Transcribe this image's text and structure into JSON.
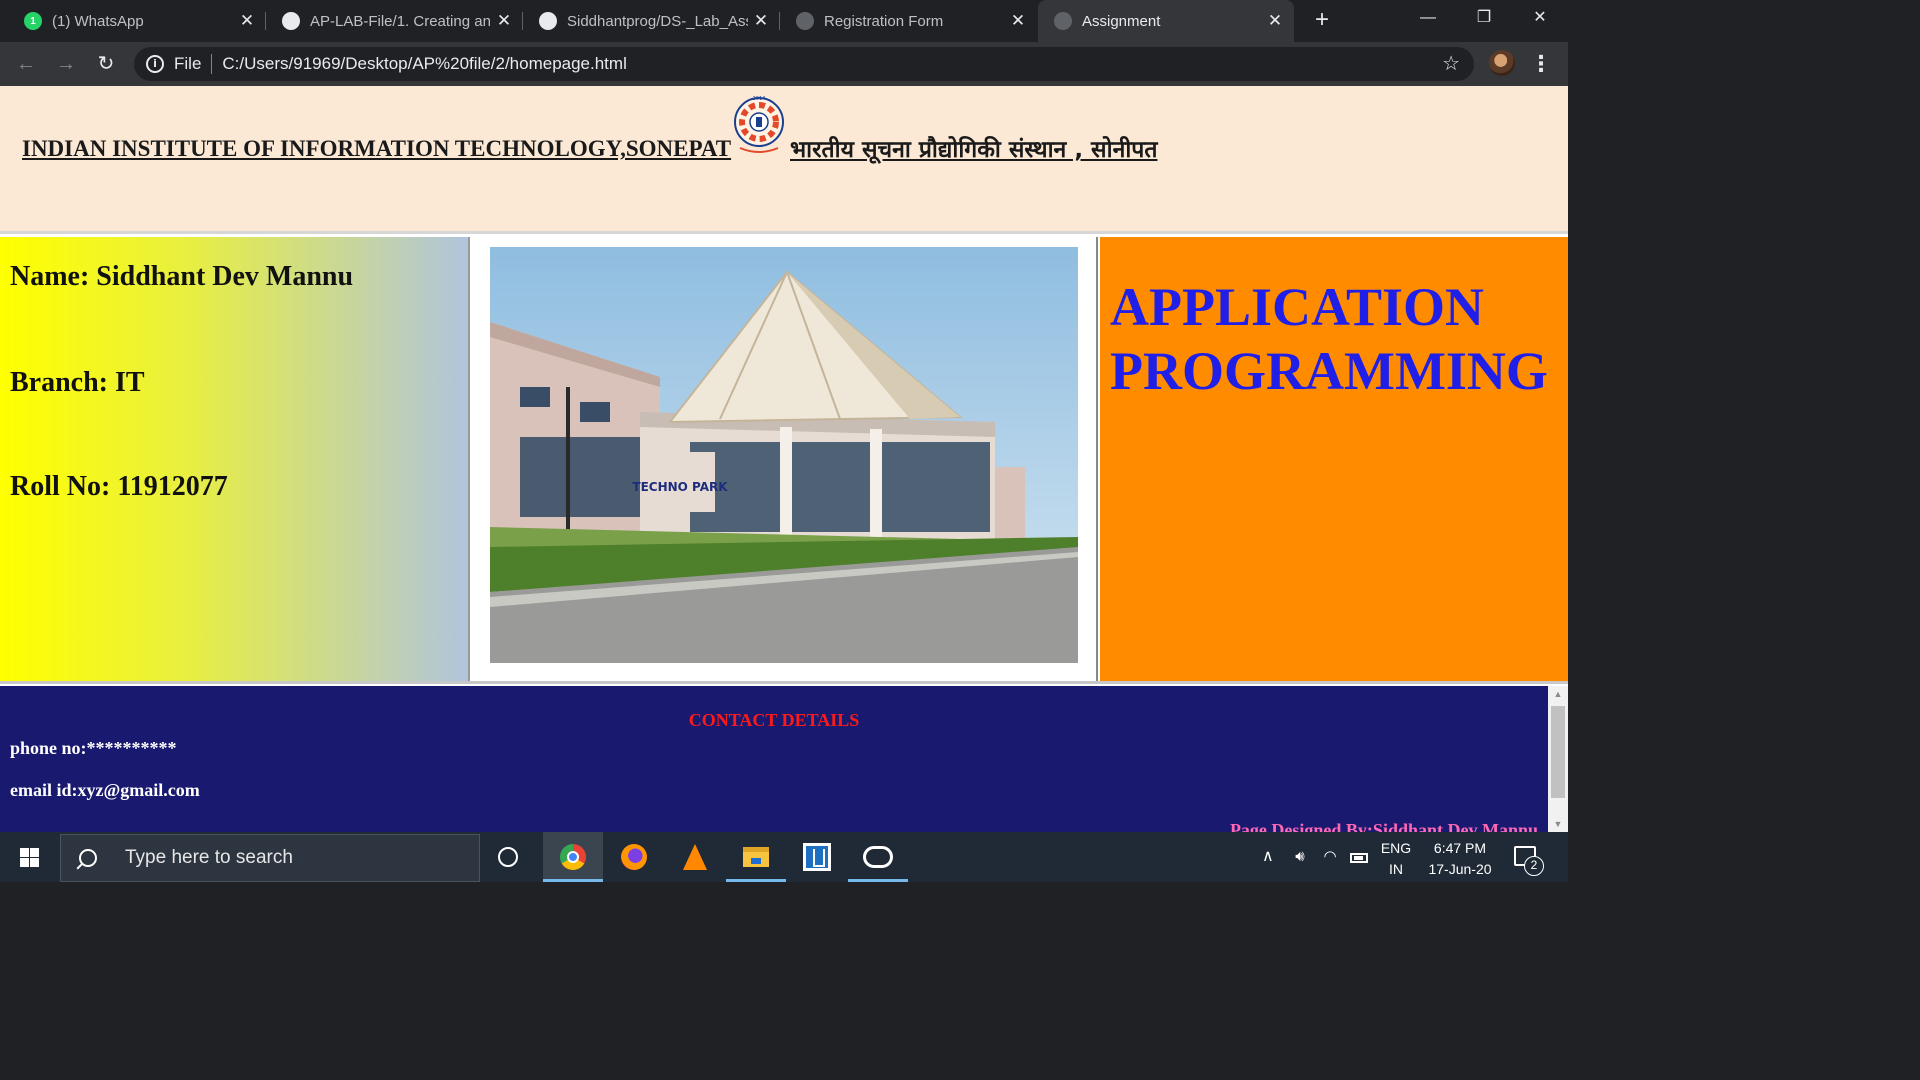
{
  "browser": {
    "tabs": [
      {
        "label": "(1) WhatsApp",
        "favicon": "whatsapp-icon",
        "active": false
      },
      {
        "label": "AP-LAB-File/1. Creating an",
        "favicon": "github-icon",
        "active": false
      },
      {
        "label": "Siddhantprog/DS-_Lab_Assi",
        "favicon": "github-icon",
        "active": false
      },
      {
        "label": "Registration Form",
        "favicon": "globe-icon",
        "active": false
      },
      {
        "label": "Assignment",
        "favicon": "globe-icon",
        "active": true
      }
    ],
    "whatsapp_badge": "1",
    "new_tab_glyph": "+",
    "close_glyph": "✕",
    "address": {
      "scheme_label": "File",
      "url": "C:/Users/91969/Desktop/AP%20file/2/homepage.html"
    }
  },
  "page": {
    "header": {
      "institute_en": "INDIAN INSTITUTE OF INFORMATION TECHNOLOGY,SONEPAT",
      "institute_hi": "भारतीय सूचना प्रौद्योगिकी संस्थान , सोनीपत",
      "logo_year": "2014"
    },
    "student": {
      "name_line": "Name: Siddhant Dev Mannu",
      "branch_line": "Branch: IT",
      "roll_line": "Roll No: 11912077"
    },
    "campus_photo": {
      "sign_text": "TECHNO PARK"
    },
    "subject": {
      "line1": "APPLICATION",
      "line2": "PROGRAMMING"
    },
    "footer": {
      "title": "CONTACT DETAILS",
      "phone": "phone no:**********",
      "email": "email id:xyz@gmail.com",
      "designer": "Page Designed By:Siddhant Dev Mannu"
    },
    "colors": {
      "header_bg": "#fbe9d6",
      "left_gradient_start": "#ffff00",
      "left_gradient_end": "#b0c4de",
      "right_bg": "#ff8c00",
      "subject_text": "#1f1fe8",
      "footer_bg": "#191970",
      "contact_title": "#ff1a1a",
      "designer_text": "#ff69b4"
    }
  },
  "taskbar": {
    "search_placeholder": "Type here to search",
    "apps": [
      "chrome-icon",
      "firefox-icon",
      "vlc-icon",
      "file-explorer-icon",
      "code-editor-icon",
      "game-bar-icon"
    ],
    "language_line1": "ENG",
    "language_line2": "IN",
    "time": "6:47 PM",
    "date": "17-Jun-20",
    "notification_count": "2"
  }
}
